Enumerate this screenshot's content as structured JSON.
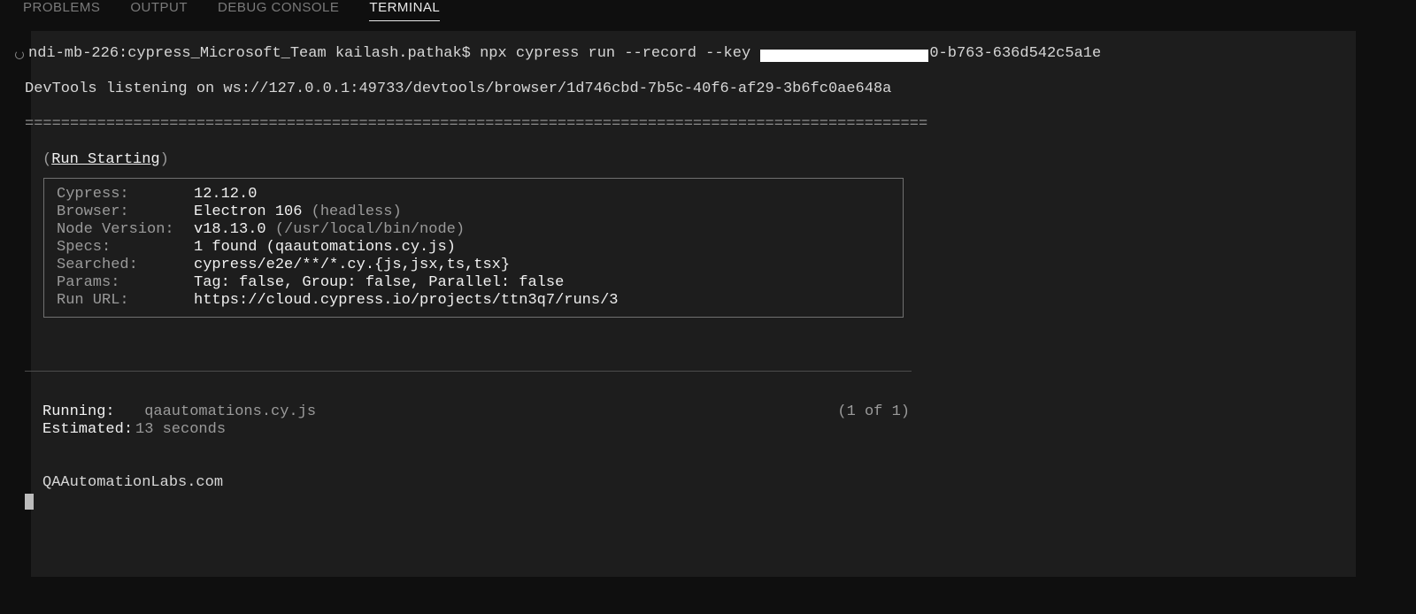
{
  "tabs": {
    "problems": "PROBLEMS",
    "output": "OUTPUT",
    "debug_console": "DEBUG CONSOLE",
    "terminal": "TERMINAL"
  },
  "prompt": {
    "host": "ndi-mb-226:cypress_Microsoft_Team kailash.pathak$ ",
    "cmd_before_key": "npx cypress run --record --key ",
    "cmd_after_key": "0-b763-636d542c5a1e"
  },
  "devtools": "DevTools listening on ws://127.0.0.1:49733/devtools/browser/1d746cbd-7b5c-40f6-af29-3b6fc0ae648a",
  "divider": "====================================================================================================",
  "run_starting": {
    "open": "(",
    "text": "Run Starting",
    "close": ")"
  },
  "info": {
    "cypress_label": "Cypress:",
    "cypress_value": "12.12.0",
    "browser_label": "Browser:",
    "browser_value": "Electron 106 ",
    "browser_note": "(headless)",
    "node_label": "Node Version:",
    "node_value": "v18.13.0 ",
    "node_note": "(/usr/local/bin/node)",
    "specs_label": "Specs:",
    "specs_value": "1 found (qaautomations.cy.js)",
    "searched_label": "Searched:",
    "searched_value": "cypress/e2e/**/*.cy.{js,jsx,ts,tsx}",
    "params_label": "Params:",
    "params_value": "Tag: false, Group: false, Parallel: false",
    "runurl_label": "Run URL:",
    "runurl_value": "https://cloud.cypress.io/projects/ttn3q7/runs/3"
  },
  "running": {
    "label": "Running:",
    "file": "qaautomations.cy.js",
    "count": "(1 of 1)",
    "est_label": "Estimated:",
    "est_value": "13 seconds"
  },
  "site": "QAAutomationLabs.com"
}
